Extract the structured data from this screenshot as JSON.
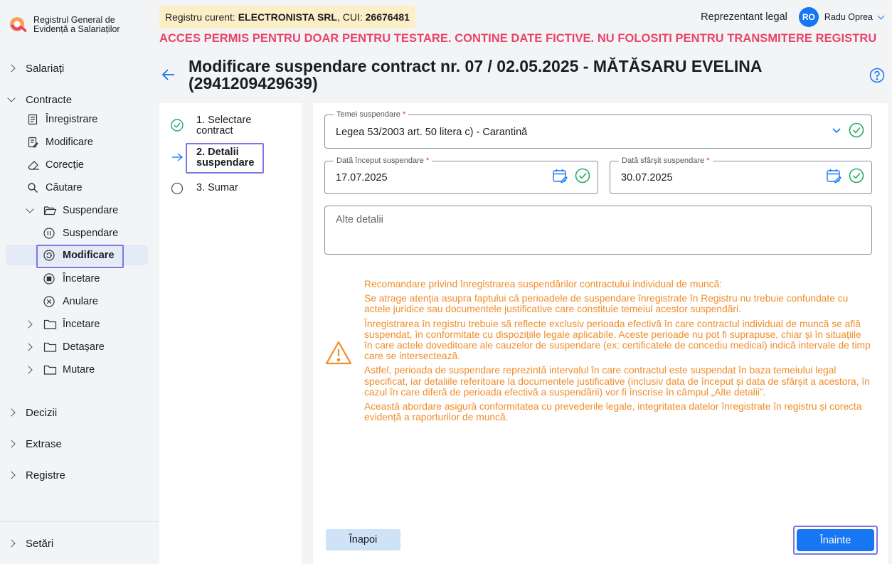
{
  "app": {
    "logo_line1": "Registrul General de",
    "logo_line2": "Evidență a Salariaților"
  },
  "header": {
    "registry_prefix": "Registru curent:",
    "registry_name": "ELECTRONISTA SRL",
    "cui_prefix": ", CUI:",
    "cui": "26676481",
    "warning": "ACCES PERMIS PENTRU DOAR PENTRU TESTARE. CONTINE DATE FICTIVE. NU FOLOSITI PENTRU TRANSMITERE REGISTRU",
    "user_role": "Reprezentant legal",
    "user_initials": "RO",
    "user_name": "Radu Oprea"
  },
  "sidebar": {
    "salariati": "Salariați",
    "contracte": "Contracte",
    "inregistrare": "Înregistrare",
    "modificare": "Modificare",
    "corectie": "Corecție",
    "cautare": "Căutare",
    "suspendare_folder": "Suspendare",
    "suspendare": "Suspendare",
    "modificare_active": "Modificare",
    "incetare_item": "Încetare",
    "anulare": "Anulare",
    "incetare_folder": "Încetare",
    "detasare": "Detașare",
    "mutare": "Mutare",
    "decizii": "Decizii",
    "extrase": "Extrase",
    "registre": "Registre",
    "setari": "Setări"
  },
  "page": {
    "title": "Modificare suspendare contract nr. 07 / 02.05.2025 - MĂTĂSARU  EVELINA (2941209429639)"
  },
  "steps": {
    "step1_line1": "1. Selectare",
    "step1_line2": "contract",
    "step2_line1": "2. Detalii",
    "step2_line2": "suspendare",
    "step3": "3. Sumar"
  },
  "form": {
    "temei_label": "Temei suspendare",
    "temei_value": "Legea 53/2003 art. 50 litera c) - Carantină",
    "start_label": "Dată început suspendare",
    "start_value": "17.07.2025",
    "end_label": "Dată sfârșit suspendare",
    "end_value": "30.07.2025",
    "details_placeholder": "Alte detalii",
    "required_mark": "*"
  },
  "alert": {
    "title": "Recomandare privind înregistrarea suspendărilor contractului individual de muncă:",
    "p1": "Se atrage atenția asupra faptului că perioadele de suspendare înregistrate în Registru nu trebuie confundate cu actele juridice sau documentele justificative care constituie temeiul acestor suspendări.",
    "p2": "Înregistrarea în registru trebuie să reflecte exclusiv perioada efectivă în care contractul individual de muncă se află suspendat, în conformitate cu dispozițiile legale aplicabile. Aceste perioade nu pot fi suprapuse, chiar și în situațiile în care actele doveditoare ale cauzelor de suspendare (ex: certificatele de concediu medical) indică intervale de timp care se intersectează.",
    "p3": "Astfel, perioada de suspendare reprezintă intervalul în care contractul este suspendat în baza temeiului legal specificat, iar detaliile referitoare la documentele justificative (inclusiv data de început și data de sfârșit a acestora, în cazul în care diferă de perioada efectivă a suspendării) vor fi înscrise în câmpul „Alte detalii”.",
    "p4": "Această abordare asigură conformitatea cu prevederile legale, integritatea datelor înregistrate în registru și corecta evidență a raporturilor de muncă."
  },
  "buttons": {
    "back": "Înapoi",
    "next": "Înainte"
  },
  "colors": {
    "primary": "#1676f3",
    "warning_banner": "#e8446a",
    "alert": "#f28c28",
    "success": "#2aa86b",
    "highlight": "#7b78e5"
  }
}
